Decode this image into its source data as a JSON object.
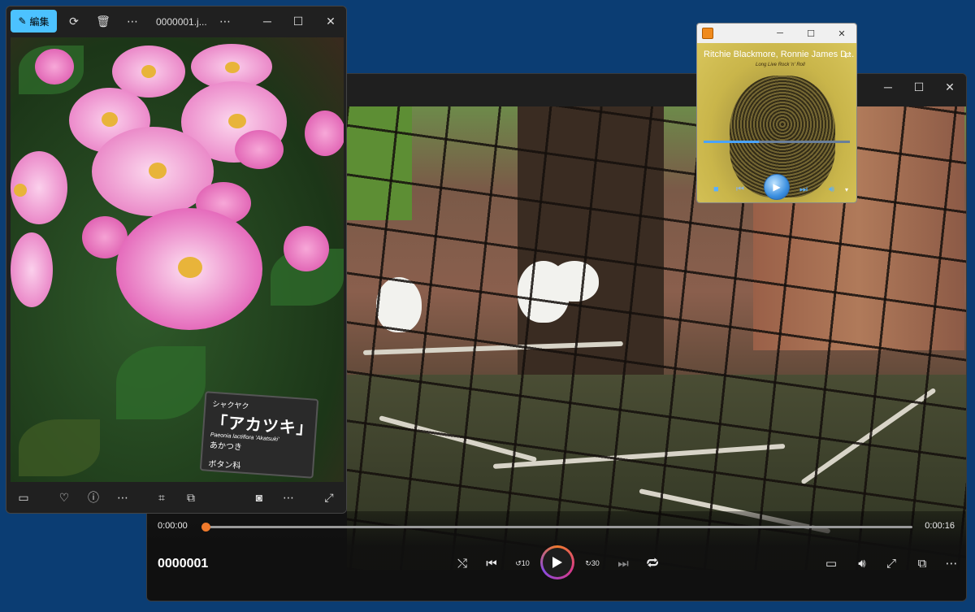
{
  "video_player": {
    "title": "0000001",
    "current_time": "0:00:00",
    "duration": "0:00:16",
    "progress": 0.0,
    "skip_back_label": "10",
    "skip_forward_label": "30",
    "accent_color": "#f07a2c"
  },
  "photos": {
    "edit_label": "編集",
    "filename": "0000001.j...",
    "sign": {
      "line1": "シャクヤク",
      "line2": "「アカツキ」",
      "line3": "Paeonia lactiflora 'Akatsuki'",
      "line4": "あかつき",
      "line5": "ボタン科"
    }
  },
  "music_player": {
    "song": "Ritchie Blackmore, Ronnie James D...",
    "album_caption": "Long Live Rock 'n' Roll",
    "progress": 0.38
  },
  "icons": [
    "minimize-icon",
    "maximize-icon",
    "close-icon",
    "edit-icon",
    "rotate-icon",
    "trash-icon",
    "more-icon",
    "filmstrip-icon",
    "heart-icon",
    "info-icon",
    "crop-icon",
    "ocr-icon",
    "screen-icon",
    "expand-icon",
    "shuffle-icon",
    "previous-icon",
    "replay-icon",
    "play-icon",
    "forward-icon",
    "next-icon",
    "repeat-icon",
    "subtitles-icon",
    "volume-icon",
    "fullscreen-icon",
    "miniplayer-icon",
    "stop-icon",
    "rewind-icon",
    "fast-forward-icon"
  ]
}
